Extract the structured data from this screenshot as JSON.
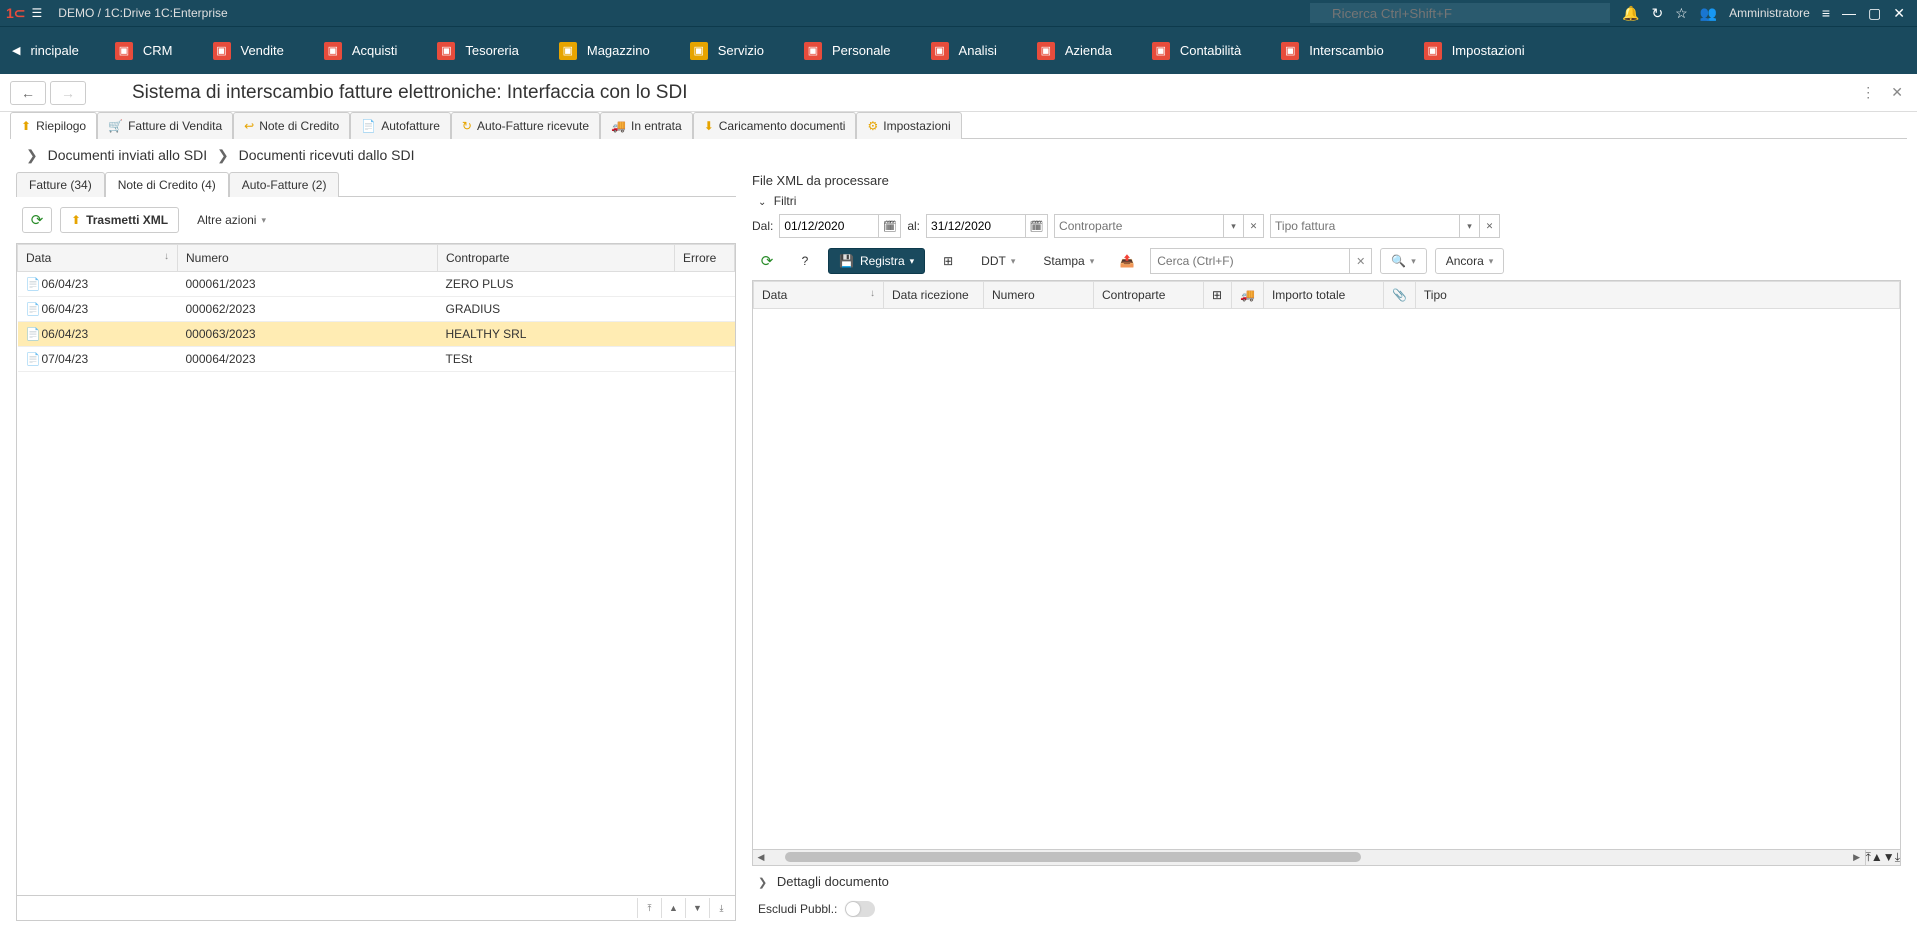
{
  "titlebar": {
    "app_title": "DEMO / 1C:Drive 1C:Enterprise",
    "search_placeholder": "Ricerca Ctrl+Shift+F",
    "user_label": "Amministratore"
  },
  "mainnav": {
    "scroll_label": "rincipale",
    "items": [
      {
        "label": "CRM",
        "icon_bg": "#e74c3c"
      },
      {
        "label": "Vendite",
        "icon_bg": "#e74c3c"
      },
      {
        "label": "Acquisti",
        "icon_bg": "#e74c3c"
      },
      {
        "label": "Tesoreria",
        "icon_bg": "#e74c3c"
      },
      {
        "label": "Magazzino",
        "icon_bg": "#e6a400"
      },
      {
        "label": "Servizio",
        "icon_bg": "#e6a400"
      },
      {
        "label": "Personale",
        "icon_bg": "#e74c3c"
      },
      {
        "label": "Analisi",
        "icon_bg": "#e74c3c"
      },
      {
        "label": "Azienda",
        "icon_bg": "#e74c3c"
      },
      {
        "label": "Contabilità",
        "icon_bg": "#e74c3c"
      },
      {
        "label": "Interscambio",
        "icon_bg": "#e74c3c"
      },
      {
        "label": "Impostazioni",
        "icon_bg": "#e74c3c"
      }
    ]
  },
  "page": {
    "title": "Sistema di interscambio fatture elettroniche: Interfaccia con lo SDI"
  },
  "section_tabs": [
    {
      "label": "Riepilogo",
      "active": true
    },
    {
      "label": "Fatture di Vendita"
    },
    {
      "label": "Note di Credito"
    },
    {
      "label": "Autofatture"
    },
    {
      "label": "Auto-Fatture ricevute"
    },
    {
      "label": "In entrata"
    },
    {
      "label": "Caricamento documenti"
    },
    {
      "label": "Impostazioni"
    }
  ],
  "breadcrumb": {
    "a": "Documenti inviati allo SDI",
    "b": "Documenti ricevuti dallo SDI"
  },
  "inner_tabs": [
    {
      "label": "Fatture (34)"
    },
    {
      "label": "Note di Credito (4)",
      "active": true
    },
    {
      "label": "Auto-Fatture (2)"
    }
  ],
  "left_toolbar": {
    "transmit": "Trasmetti XML",
    "other_actions": "Altre azioni"
  },
  "left_table": {
    "headers": {
      "data": "Data",
      "numero": "Numero",
      "controparte": "Controparte",
      "errore": "Errore"
    },
    "rows": [
      {
        "data": "06/04/23",
        "numero": "000061/2023",
        "controparte": "ZERO PLUS",
        "errore": ""
      },
      {
        "data": "06/04/23",
        "numero": "000062/2023",
        "controparte": "GRADIUS",
        "errore": ""
      },
      {
        "data": "06/04/23",
        "numero": "000063/2023",
        "controparte": "HEALTHY SRL",
        "errore": "",
        "selected": true
      },
      {
        "data": "07/04/23",
        "numero": "000064/2023",
        "controparte": "TESt",
        "errore": ""
      }
    ]
  },
  "right": {
    "section_title": "File XML da processare",
    "filters_label": "Filtri",
    "dal_label": "Dal:",
    "dal_value": "01/12/2020",
    "al_label": "al:",
    "al_value": "31/12/2020",
    "controparte_placeholder": "Controparte",
    "tipo_fattura_placeholder": "Tipo fattura",
    "registra": "Registra",
    "ddt": "DDT",
    "stampa": "Stampa",
    "search_placeholder": "Cerca (Ctrl+F)",
    "ancora": "Ancora",
    "headers": {
      "data": "Data",
      "ricezione": "Data ricezione",
      "numero": "Numero",
      "controparte": "Controparte",
      "importo": "Importo totale",
      "tipo": "Tipo"
    },
    "details": "Dettagli documento",
    "escludi": "Escludi Pubbl.:"
  }
}
